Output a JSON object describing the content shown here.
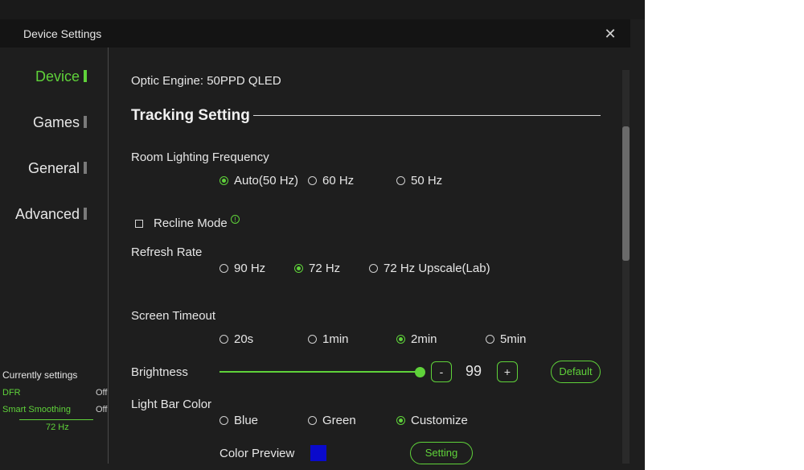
{
  "window": {
    "title": "Device Settings",
    "close_icon": "close-icon"
  },
  "sidebar": {
    "items": [
      {
        "label": "Device",
        "active": true
      },
      {
        "label": "Games",
        "active": false
      },
      {
        "label": "General",
        "active": false
      },
      {
        "label": "Advanced",
        "active": false
      }
    ]
  },
  "current": {
    "title": "Currently settings",
    "dfr_label": "DFR",
    "dfr_value": "Off",
    "smooth_label": "Smart Smoothing",
    "smooth_value": "Off",
    "hz": "72 Hz"
  },
  "main": {
    "optic_engine": "Optic Engine: 50PPD QLED",
    "tracking_title": "Tracking Setting",
    "room_lighting": {
      "label": "Room Lighting Frequency",
      "options": [
        "Auto(50 Hz)",
        "60 Hz",
        "50 Hz"
      ],
      "selected": "Auto(50 Hz)"
    },
    "recline": {
      "label": "Recline Mode",
      "checked": false,
      "info_icon": "info-icon"
    },
    "refresh_rate": {
      "label": "Refresh Rate",
      "options": [
        "90 Hz",
        "72 Hz",
        "72 Hz Upscale(Lab)"
      ],
      "selected": "72 Hz"
    },
    "screen_timeout": {
      "label": "Screen Timeout",
      "options": [
        "20s",
        "1min",
        "2min",
        "5min"
      ],
      "selected": "2min"
    },
    "brightness": {
      "label": "Brightness",
      "value": "99",
      "level": 0.99,
      "minus": "-",
      "plus": "+",
      "default_label": "Default"
    },
    "light_bar": {
      "label": "Light Bar Color",
      "options": [
        "Blue",
        "Green",
        "Customize"
      ],
      "selected": "Customize",
      "preview_label": "Color Preview",
      "preview_color": "#0a0acc",
      "setting_label": "Setting"
    }
  },
  "colors": {
    "accent": "#5fd23a",
    "background": "#1e1e1e",
    "titlebar": "#141414"
  }
}
